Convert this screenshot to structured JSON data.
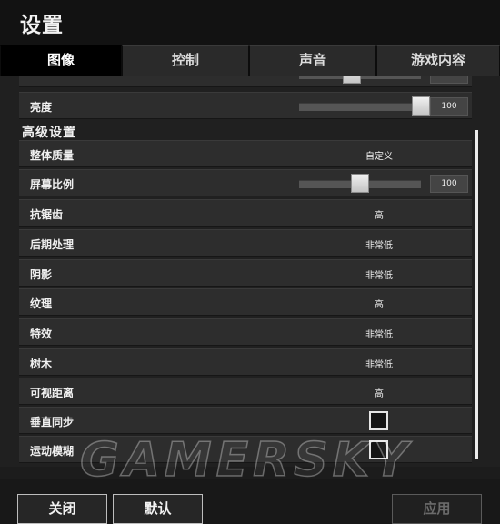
{
  "window": {
    "title": "设置"
  },
  "tabs": [
    {
      "label": "图像",
      "active": true
    },
    {
      "label": "控制",
      "active": false
    },
    {
      "label": "声音",
      "active": false
    },
    {
      "label": "游戏内容",
      "active": false
    }
  ],
  "brightness": {
    "label": "亮度",
    "value": "100",
    "level_percent": 100
  },
  "advanced": {
    "section_title": "高级设置",
    "overall_quality": {
      "label": "整体质量",
      "value": "自定义"
    },
    "screen_ratio": {
      "label": "屏幕比例",
      "value": "100",
      "level_percent": 50
    },
    "anti_aliasing": {
      "label": "抗锯齿",
      "value": "高"
    },
    "post_processing": {
      "label": "后期处理",
      "value": "非常低"
    },
    "shadows": {
      "label": "阴影",
      "value": "非常低"
    },
    "textures": {
      "label": "纹理",
      "value": "高"
    },
    "effects": {
      "label": "特效",
      "value": "非常低"
    },
    "trees": {
      "label": "树木",
      "value": "非常低"
    },
    "view_distance": {
      "label": "可视距离",
      "value": "高"
    },
    "vsync": {
      "label": "垂直同步",
      "checked": false
    },
    "motion_blur": {
      "label": "运动模糊",
      "checked": false
    }
  },
  "footer": {
    "close_label": "关闭",
    "default_label": "默认",
    "apply_label": "应用",
    "apply_enabled": false
  },
  "watermark": "GAMERSKY",
  "colors": {
    "background": "#1c1c1c",
    "row": "#2d2d2d",
    "active_tab": "#000000",
    "tab": "#2a2a2a",
    "text": "#f0f0f0",
    "disabled": "#6b6b6b"
  }
}
